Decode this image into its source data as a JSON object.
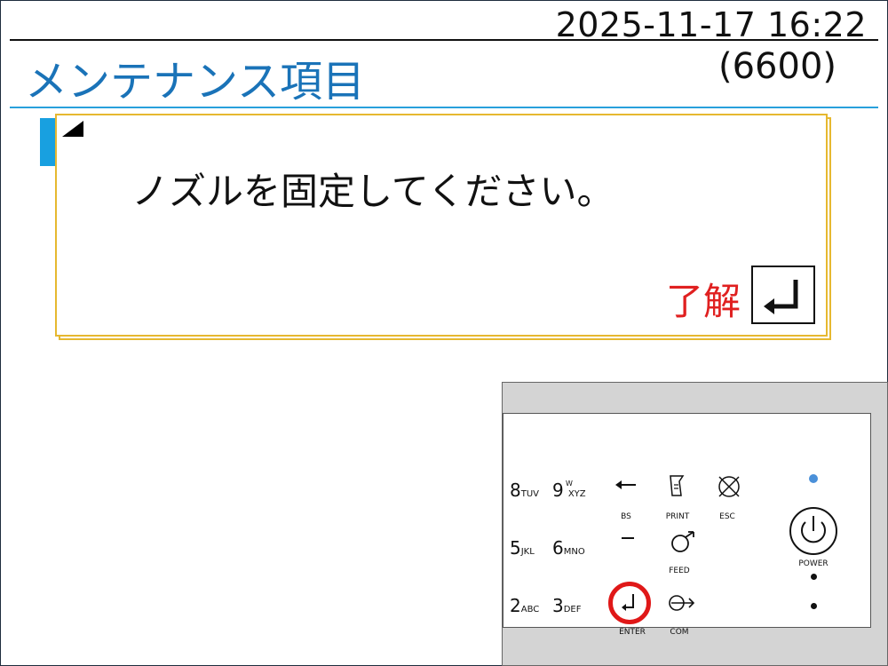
{
  "header": {
    "datetime": "2025-11-17 16:22",
    "title": "メンテナンス項目",
    "code": "(6600)"
  },
  "dialog": {
    "message": "ノズルを固定してください。",
    "ok_label": "了解"
  },
  "keypad": {
    "keys": [
      {
        "digit": "8",
        "letters": "TUV"
      },
      {
        "digit": "9",
        "letters_top": "W",
        "letters": "XYZ"
      },
      {
        "digit": "5",
        "letters": "JKL"
      },
      {
        "digit": "6",
        "letters": "MNO"
      },
      {
        "digit": "2",
        "letters": "ABC"
      },
      {
        "digit": "3",
        "letters": "DEF"
      }
    ],
    "labels": {
      "bs": "BS",
      "print": "PRINT",
      "esc": "ESC",
      "feed": "FEED",
      "enter": "ENTER",
      "com": "COM",
      "power": "POWER"
    },
    "highlight_color": "#e01818",
    "power_led_color": "#4a90d9"
  },
  "colors": {
    "title": "#1a73b8",
    "accent": "#18a0e0",
    "dialog_border": "#e6b830",
    "ok_label": "#e02020"
  }
}
